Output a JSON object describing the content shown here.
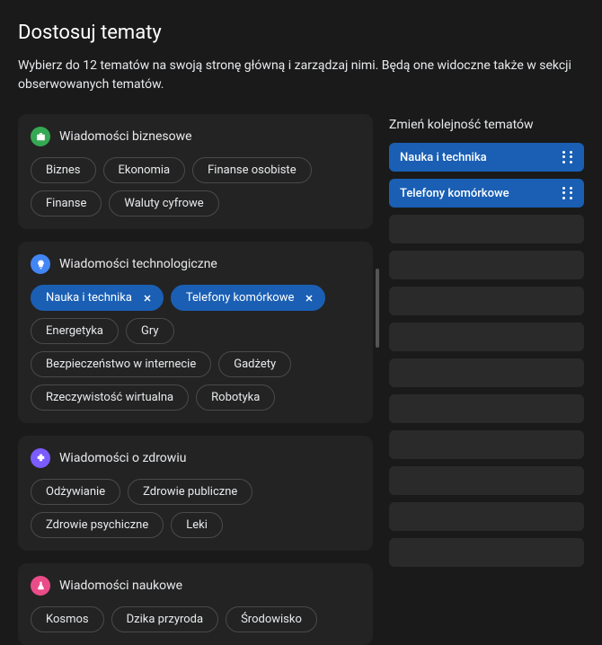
{
  "header": {
    "title": "Dostosuj tematy",
    "subtitle": "Wybierz do 12 tematów na swoją stronę główną i zarządzaj nimi. Będą one widoczne także w sekcji obserwowanych tematów."
  },
  "colors": {
    "selected": "#1a5fb4"
  },
  "categories": [
    {
      "id": "business",
      "icon": "briefcase",
      "iconBg": "ic-bg-green",
      "title": "Wiadomości biznesowe",
      "chips": [
        {
          "label": "Biznes",
          "selected": false
        },
        {
          "label": "Ekonomia",
          "selected": false
        },
        {
          "label": "Finanse osobiste",
          "selected": false
        },
        {
          "label": "Finanse",
          "selected": false
        },
        {
          "label": "Waluty cyfrowe",
          "selected": false
        }
      ]
    },
    {
      "id": "tech",
      "icon": "lightbulb",
      "iconBg": "ic-bg-blue",
      "title": "Wiadomości technologiczne",
      "chips": [
        {
          "label": "Nauka i technika",
          "selected": true
        },
        {
          "label": "Telefony komórkowe",
          "selected": true
        },
        {
          "label": "Energetyka",
          "selected": false
        },
        {
          "label": "Gry",
          "selected": false
        },
        {
          "label": "Bezpieczeństwo w internecie",
          "selected": false
        },
        {
          "label": "Gadżety",
          "selected": false
        },
        {
          "label": "Rzeczywistość wirtualna",
          "selected": false
        },
        {
          "label": "Robotyka",
          "selected": false
        }
      ]
    },
    {
      "id": "health",
      "icon": "health",
      "iconBg": "ic-bg-purple",
      "title": "Wiadomości o zdrowiu",
      "chips": [
        {
          "label": "Odżywianie",
          "selected": false
        },
        {
          "label": "Zdrowie publiczne",
          "selected": false
        },
        {
          "label": "Zdrowie psychiczne",
          "selected": false
        },
        {
          "label": "Leki",
          "selected": false
        }
      ]
    },
    {
      "id": "science",
      "icon": "flask",
      "iconBg": "ic-bg-pink",
      "title": "Wiadomości naukowe",
      "chips": [
        {
          "label": "Kosmos",
          "selected": false
        },
        {
          "label": "Dzika przyroda",
          "selected": false
        },
        {
          "label": "Środowisko",
          "selected": false
        }
      ]
    }
  ],
  "reorder": {
    "title": "Zmień kolejność tematów",
    "totalSlots": 12,
    "items": [
      {
        "label": "Nauka i technika"
      },
      {
        "label": "Telefony komórkowe"
      }
    ]
  }
}
